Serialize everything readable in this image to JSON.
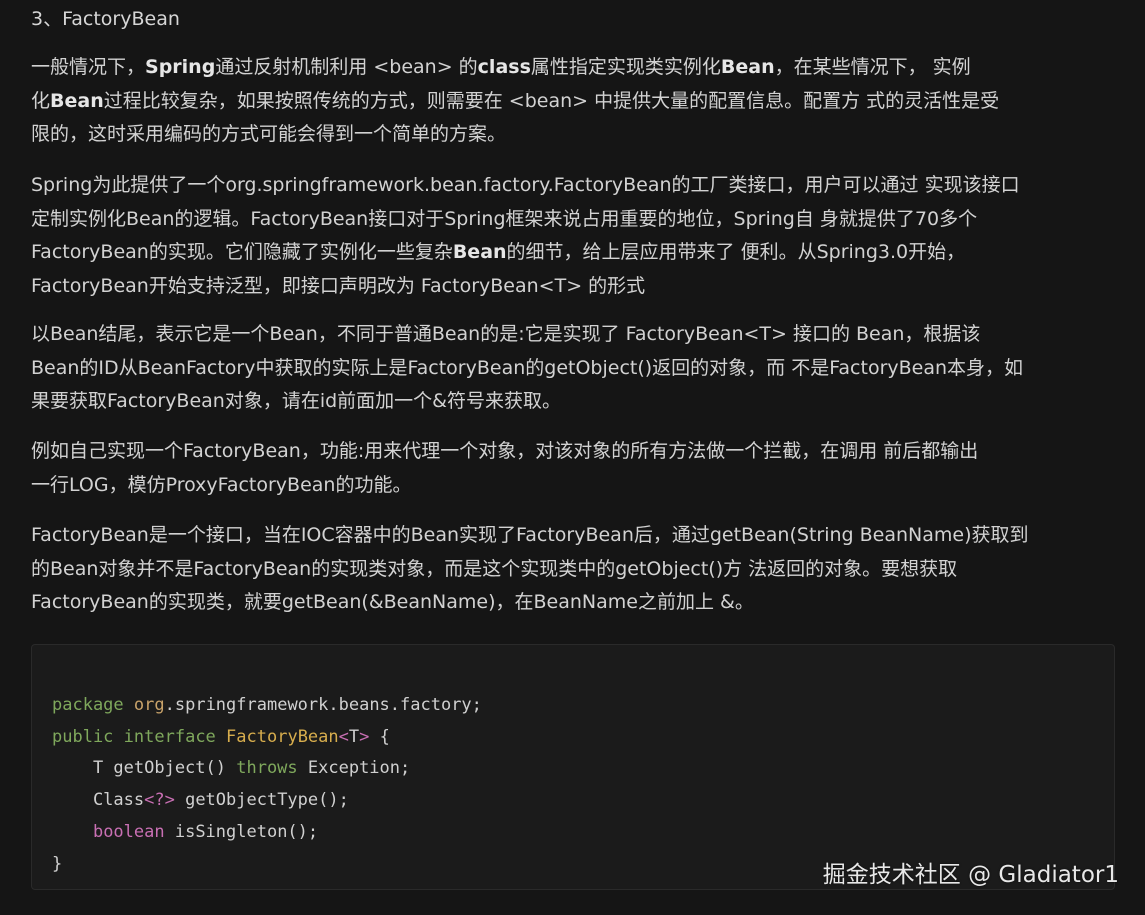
{
  "heading": "3、FactoryBean",
  "paragraphs": {
    "p1": [
      [
        {
          "t": "一般情况下，"
        },
        {
          "t": "Spring",
          "b": true
        },
        {
          "t": "通过反射机制利用 <bean> 的"
        },
        {
          "t": "class",
          "b": true
        },
        {
          "t": "属性指定实现类实例化"
        },
        {
          "t": "Bean",
          "b": true
        },
        {
          "t": "，在某些情况下， 实例"
        }
      ],
      [
        {
          "t": "化"
        },
        {
          "t": "Bean",
          "b": true
        },
        {
          "t": "过程比较复杂，如果按照传统的方式，则需要在 <bean> 中提供大量的配置信息。配置方 式的灵活性是受"
        }
      ],
      [
        {
          "t": "限的，这时采用编码的方式可能会得到一个简单的方案。"
        }
      ]
    ],
    "p2": [
      [
        {
          "t": "Spring为此提供了一个org.springframework.bean.factory.FactoryBean的工厂类接口，用户可以通过 实现该接口"
        }
      ],
      [
        {
          "t": "定制实例化Bean的逻辑。FactoryBean接口对于Spring框架来说占用重要的地位，Spring自 身就提供了70多个"
        }
      ],
      [
        {
          "t": "FactoryBean的实现。它们隐藏了实例化一些复杂"
        },
        {
          "t": "Bean",
          "b": true
        },
        {
          "t": "的细节，给上层应用带来了 便利。从Spring3.0开始，"
        }
      ],
      [
        {
          "t": "FactoryBean开始支持泛型，即接口声明改为 FactoryBean<T> 的形式"
        }
      ]
    ],
    "p3": [
      [
        {
          "t": "以Bean结尾，表示它是一个Bean，不同于普通Bean的是:它是实现了 FactoryBean<T> 接口的 Bean，根据该"
        }
      ],
      [
        {
          "t": "Bean的ID从BeanFactory中获取的实际上是FactoryBean的getObject()返回的对象，而 不是FactoryBean本身，如"
        }
      ],
      [
        {
          "t": "果要获取FactoryBean对象，请在id前面加一个&符号来获取。"
        }
      ]
    ],
    "p4": [
      [
        {
          "t": "例如自己实现一个FactoryBean，功能:用来代理一个对象，对该对象的所有方法做一个拦截，在调用 前后都输出"
        }
      ],
      [
        {
          "t": "一行LOG，模仿ProxyFactoryBean的功能。"
        }
      ]
    ],
    "p5": [
      [
        {
          "t": "FactoryBean是一个接口，当在IOC容器中的Bean实现了FactoryBean后，通过getBean(String BeanName)获取到"
        }
      ],
      [
        {
          "t": "的Bean对象并不是FactoryBean的实现类对象，而是这个实现类中的getObject()方 法返回的对象。要想获取"
        }
      ],
      [
        {
          "t": "FactoryBean的实现类，就要getBean(&BeanName)，在BeanName之前加上 &。"
        }
      ]
    ]
  },
  "code_lines": [
    [
      {
        "t": "package",
        "c": "kw"
      },
      {
        "t": " "
      },
      {
        "t": "org",
        "c": "ns"
      },
      {
        "t": ".springframework.beans.factory;"
      }
    ],
    [
      {
        "t": "public",
        "c": "kw"
      },
      {
        "t": " "
      },
      {
        "t": "interface",
        "c": "kw"
      },
      {
        "t": " "
      },
      {
        "t": "FactoryBean",
        "c": "cls"
      },
      {
        "t": "<",
        "c": "op"
      },
      {
        "t": "T"
      },
      {
        "t": ">",
        "c": "op"
      },
      {
        "t": " {"
      }
    ],
    [
      {
        "t": "    T getObject() "
      },
      {
        "t": "throws",
        "c": "kw"
      },
      {
        "t": " Exception;"
      }
    ],
    [
      {
        "t": "    Class"
      },
      {
        "t": "<?>",
        "c": "op"
      },
      {
        "t": " getObjectType();"
      }
    ],
    [
      {
        "t": "    "
      },
      {
        "t": "boolean",
        "c": "ty"
      },
      {
        "t": " isSingleton();"
      }
    ],
    [
      {
        "t": "}"
      }
    ]
  ],
  "watermark": "掘金技术社区 @ Gladiator1",
  "colors": {
    "background": "#151515",
    "code_background": "#1b1b1b",
    "keyword": "#7fa85c",
    "class_name": "#d7ad4d",
    "type_keyword": "#c86fb3",
    "text": "#d2d2d2"
  }
}
